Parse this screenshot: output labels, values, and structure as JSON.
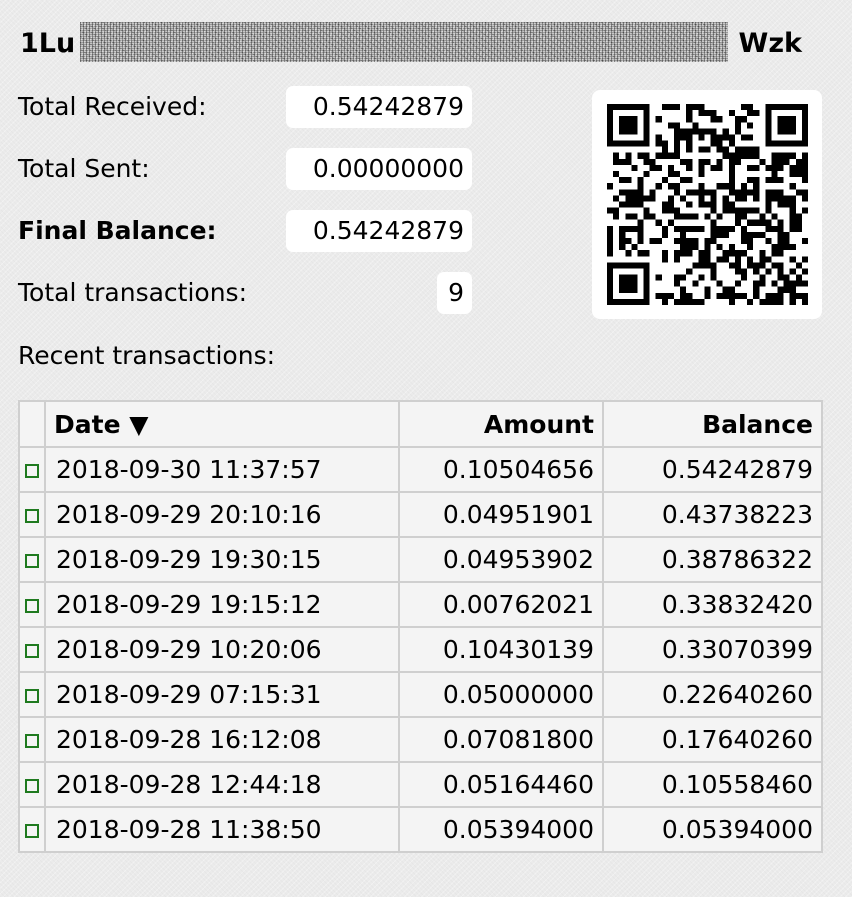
{
  "address": {
    "prefix": "1Lu",
    "suffix": "Wzk"
  },
  "summary": {
    "total_received_label": "Total Received:",
    "total_received_value": "0.54242879",
    "total_sent_label": "Total Sent:",
    "total_sent_value": "0.00000000",
    "final_balance_label": "Final Balance:",
    "final_balance_value": "0.54242879",
    "total_tx_label": "Total transactions:",
    "total_tx_value": "9"
  },
  "recent_label": "Recent transactions:",
  "table": {
    "headers": {
      "date": "Date ▼",
      "amount": "Amount",
      "balance": "Balance"
    },
    "rows": [
      {
        "date": "2018-09-30 11:37:57",
        "amount": "0.10504656",
        "balance": "0.54242879"
      },
      {
        "date": "2018-09-29 20:10:16",
        "amount": "0.04951901",
        "balance": "0.43738223"
      },
      {
        "date": "2018-09-29 19:30:15",
        "amount": "0.04953902",
        "balance": "0.38786322"
      },
      {
        "date": "2018-09-29 19:15:12",
        "amount": "0.00762021",
        "balance": "0.33832420"
      },
      {
        "date": "2018-09-29 10:20:06",
        "amount": "0.10430139",
        "balance": "0.33070399"
      },
      {
        "date": "2018-09-29 07:15:31",
        "amount": "0.05000000",
        "balance": "0.22640260"
      },
      {
        "date": "2018-09-28 16:12:08",
        "amount": "0.07081800",
        "balance": "0.17640260"
      },
      {
        "date": "2018-09-28 12:44:18",
        "amount": "0.05164460",
        "balance": "0.10558460"
      },
      {
        "date": "2018-09-28 11:38:50",
        "amount": "0.05394000",
        "balance": "0.05394000"
      }
    ]
  },
  "icons": {
    "row_link": "green-square-icon",
    "qr": "qr-code-icon",
    "redaction": "redacted-address-block"
  },
  "colors": {
    "background": "#ebebeb",
    "box": "#ffffff",
    "row_icon": "#1f7a1f",
    "table_border": "#cfcfcf"
  }
}
